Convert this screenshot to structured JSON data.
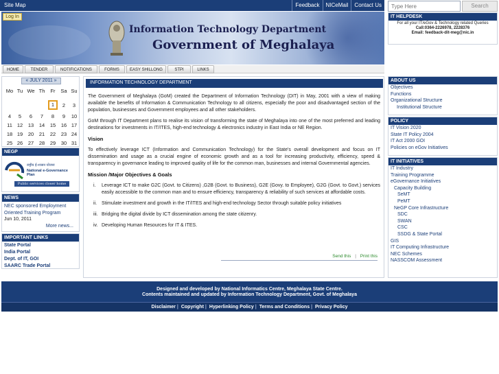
{
  "top_bar": {
    "site_map": "Site Map",
    "links": [
      "Feedback",
      "NICeMail",
      "Contact Us"
    ]
  },
  "search": {
    "placeholder": "Type Here",
    "button": "Search"
  },
  "banner": {
    "login": "Log In",
    "title_line1": "Information Technology Department",
    "title_line2": "Government of Meghalaya"
  },
  "menu": [
    "HOME",
    "TENDER",
    "NOTIFICATIONS",
    "FORMS",
    "EASY SHILLONG",
    "STPI",
    "LINKS"
  ],
  "helpdesk": {
    "title": "IT HELPDESK",
    "line1": "For all your IT/eGov & Technology related Queries",
    "line2": "Call:0364-2226978, 2228376",
    "line3": "Email: feedback-dit-meg@nic.in"
  },
  "calendar": {
    "month_label": "« JULY 2011 »",
    "days_of_week": [
      "Mo",
      "Tu",
      "We",
      "Th",
      "Fr",
      "Sa",
      "Su"
    ],
    "weeks": [
      [
        "",
        "",
        "",
        "",
        "1",
        "2",
        "3"
      ],
      [
        "4",
        "5",
        "6",
        "7",
        "8",
        "9",
        "10"
      ],
      [
        "11",
        "12",
        "13",
        "14",
        "15",
        "16",
        "17"
      ],
      [
        "18",
        "19",
        "20",
        "21",
        "22",
        "23",
        "24"
      ],
      [
        "25",
        "26",
        "27",
        "28",
        "29",
        "30",
        "31"
      ]
    ],
    "today": "1"
  },
  "negp": {
    "title": "NEGP",
    "logo_text_hindi": "राष्ट्रीय ई-शासन योजना",
    "logo_text": "National e-Governance Plan",
    "tagline": "Public services closer home"
  },
  "news": {
    "title": "NEWS",
    "item": "NEC sponsored Employment Oriented Training Program",
    "date": "Jun 10, 2011",
    "more": "More news..."
  },
  "important_links": {
    "title": "IMPORTANT LINKS",
    "items": [
      "State Portal",
      "India Portal",
      "Dept. of IT, GOI",
      "SAARC Trade Portal"
    ]
  },
  "main": {
    "heading": "INFORMATION TECHNOLOGY DEPARTMENT",
    "para1": "The Government of Meghalaya (GoM) created the Department of Information Technology (DIT) in May, 2001 with a view of making available the benefits of Information & Communication Technology to all citizens, especially the poor and disadvantaged section of the population, businesses and Government employees and all other stakeholders.",
    "para2": "GoM through IT Department plans to realise its vision of transforming the state of Meghalaya into one of the most preferred and leading destinations for investments in IT/ITES, high-end technology & electronics industry in East India or NE Region.",
    "vision_heading": "Vision",
    "vision_text": "To effectively leverage ICT (Information and Communication Technology) for the State's overall development and focus on IT dissemination and usage as a crucial engine of economic growth and as a tool for increasing productivity, efficiency, speed & transparency in governance leading to improved quality of life for the common man, businesses and internal Governmental agencies.",
    "mission_heading": "Mission /Major Objectives & Goals",
    "objectives": [
      {
        "num": "i.",
        "text": "Leverage ICT to make G2C (Govt. to Citizens) ,G2B (Govt. to Business), G2E (Govy. to Employee), G2G (Govt. to Govt.) services easily accessible to the common man and to ensure efficiency, transparency & reliability of such services at affordable costs."
      },
      {
        "num": "ii.",
        "text": "Stimulate investment and growth in the IT/ITES and high-end technology  Sector through suitable policy initiatives"
      },
      {
        "num": "iii.",
        "text": "Bridging the digital divide by ICT dissemination among the state citizenry."
      },
      {
        "num": "iv.",
        "text": "Developing Human Resources for IT & ITES."
      }
    ],
    "send": "Send this",
    "print": "Print this"
  },
  "about": {
    "title": "ABOUT US",
    "items": [
      "Objectives",
      "Functions",
      "Organizational Structure",
      "Institutional Structure"
    ]
  },
  "policy": {
    "title": "POLICY",
    "items": [
      "IT Vision 2020",
      "State IT Policy 2004",
      "IT Act 2000 GOI",
      "Policies on eGov Initiatives"
    ]
  },
  "initiatives": {
    "title": "IT INITIATIVES",
    "items": [
      {
        "label": "IT Industry",
        "indent": 0
      },
      {
        "label": "Training Programme",
        "indent": 0
      },
      {
        "label": "eGovernance Initiatives",
        "indent": 0
      },
      {
        "label": "Capacity Building",
        "indent": 1
      },
      {
        "label": "SeMT",
        "indent": 2
      },
      {
        "label": "PeMT",
        "indent": 2
      },
      {
        "label": "NeGP Core Infrastructure",
        "indent": 1
      },
      {
        "label": "SDC",
        "indent": 2
      },
      {
        "label": "SWAN",
        "indent": 2
      },
      {
        "label": "CSC",
        "indent": 2
      },
      {
        "label": "SSDG & State Portal",
        "indent": 2
      },
      {
        "label": "GIS",
        "indent": 0
      },
      {
        "label": "IT Computing Infrastructure",
        "indent": 0
      },
      {
        "label": "NEC Schemes",
        "indent": 0
      },
      {
        "label": "NASSCOM Assessment",
        "indent": 0
      }
    ]
  },
  "footer": {
    "line1": "Designed and developed by National Informatics Centre, Meghalaya State Centre.",
    "line2": "Contents maintained and updated by Information Technology Department, Govt. of Meghalaya",
    "links": [
      "Disclaimer",
      "Copyright",
      "Hyperlinking Policy",
      "Terms and Conditions",
      "Privacy Policy"
    ]
  },
  "colors": {
    "primary_navy": "#1b3e78",
    "accent_today": "#e39b1d",
    "send_print_green": "#2c8a2c"
  }
}
